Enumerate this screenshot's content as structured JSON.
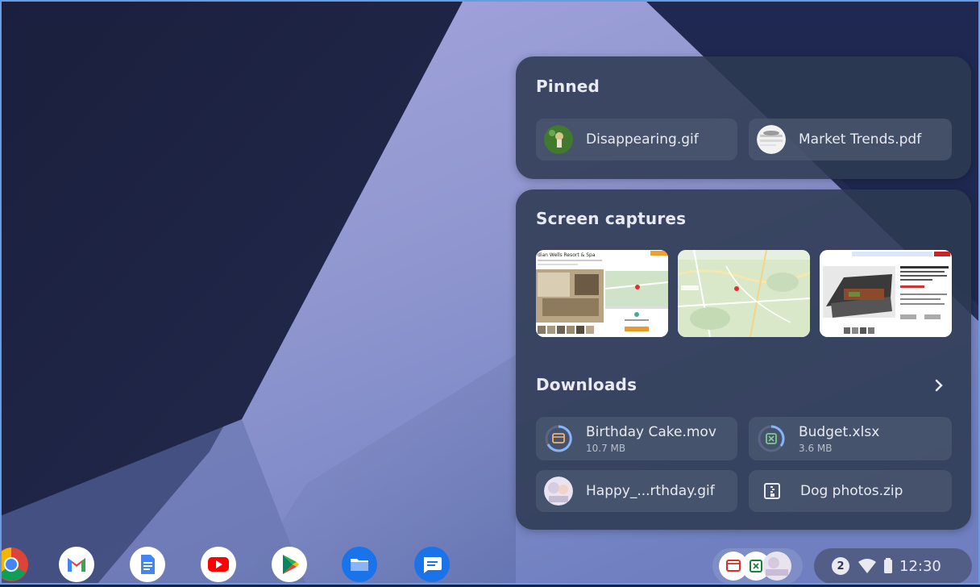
{
  "holding_space": {
    "pinned": {
      "title": "Pinned",
      "items": [
        {
          "name": "Disappearing.gif",
          "icon": "gif-thumbnail-icon"
        },
        {
          "name": "Market Trends.pdf",
          "icon": "pdf-thumbnail-icon"
        }
      ]
    },
    "screen_captures": {
      "title": "Screen captures",
      "items": [
        {
          "label": "dian Wells Resort & Spa"
        },
        {
          "label": "map-capture"
        },
        {
          "label": "product-capture"
        }
      ]
    },
    "downloads": {
      "title": "Downloads",
      "chevron": "›",
      "items": [
        {
          "name": "Birthday Cake.mov",
          "size": "10.7 MB",
          "icon": "video-progress-icon"
        },
        {
          "name": "Budget.xlsx",
          "size": "3.6 MB",
          "icon": "spreadsheet-progress-icon"
        },
        {
          "name": "Happy_...rthday.gif",
          "icon": "image-thumbnail-icon"
        },
        {
          "name": "Dog photos.zip",
          "icon": "zip-file-icon"
        }
      ]
    }
  },
  "shelf": {
    "apps": [
      "chrome",
      "gmail",
      "docs",
      "youtube",
      "play-store",
      "files",
      "messages"
    ],
    "status": {
      "notification_count": "2",
      "time": "12:30"
    }
  },
  "colors": {
    "panel": "#2e3a52",
    "chip": "#4c5870",
    "accent_blue": "#8ab4f8"
  }
}
